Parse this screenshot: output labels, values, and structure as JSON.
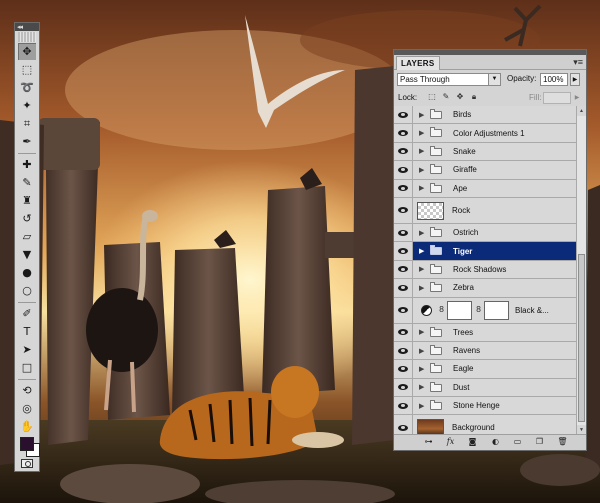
{
  "toolbox": {
    "collapse_glyph": "◂◂",
    "tools": [
      {
        "icon": "move-icon",
        "glyph": "✥",
        "active": true
      },
      {
        "icon": "marquee-icon",
        "glyph": "⬚"
      },
      {
        "icon": "lasso-icon",
        "glyph": "➰"
      },
      {
        "icon": "magic-wand-icon",
        "glyph": "✦"
      },
      {
        "icon": "crop-icon",
        "glyph": "⌗"
      },
      {
        "icon": "eyedropper-icon",
        "glyph": "✒"
      },
      {
        "sep": true
      },
      {
        "icon": "healing-brush-icon",
        "glyph": "✚"
      },
      {
        "icon": "brush-icon",
        "glyph": "✎"
      },
      {
        "icon": "clone-stamp-icon",
        "glyph": "♜"
      },
      {
        "icon": "history-brush-icon",
        "glyph": "↺"
      },
      {
        "icon": "eraser-icon",
        "glyph": "▱"
      },
      {
        "icon": "paint-bucket-icon",
        "glyph": "▼"
      },
      {
        "icon": "blur-icon",
        "glyph": "●"
      },
      {
        "icon": "dodge-icon",
        "glyph": "○"
      },
      {
        "sep": true
      },
      {
        "icon": "pen-icon",
        "glyph": "✐"
      },
      {
        "icon": "type-icon",
        "glyph": "T"
      },
      {
        "icon": "path-selection-icon",
        "glyph": "➤"
      },
      {
        "icon": "rectangle-shape-icon",
        "glyph": "□"
      },
      {
        "sep": true
      },
      {
        "icon": "3d-rotate-icon",
        "glyph": "⟲"
      },
      {
        "icon": "3d-orbit-icon",
        "glyph": "◎"
      },
      {
        "icon": "hand-icon",
        "glyph": "✋"
      },
      {
        "icon": "zoom-icon",
        "glyph": "⚲"
      }
    ],
    "foreground_color": "#2b0f2e",
    "background_color": "#ffffff",
    "quick_mask_icon": "quick-mask-icon"
  },
  "layers_panel": {
    "tab_label": "LAYERS",
    "menu_glyph": "▾≡",
    "blend_mode": "Pass Through",
    "opacity_label": "Opacity:",
    "opacity_value": "100%",
    "lock_label": "Lock:",
    "fill_label": "Fill:",
    "fill_value": "",
    "selected_color": "#0b2a78",
    "layers": [
      {
        "name": "Birds",
        "kind": "group"
      },
      {
        "name": "Color Adjustments 1",
        "kind": "group"
      },
      {
        "name": "Snake",
        "kind": "group"
      },
      {
        "name": "Giraffe",
        "kind": "group"
      },
      {
        "name": "Ape",
        "kind": "group"
      },
      {
        "name": "Rock",
        "kind": "pixel"
      },
      {
        "name": "Ostrich",
        "kind": "group"
      },
      {
        "name": "Tiger",
        "kind": "group",
        "selected": true
      },
      {
        "name": "Rock Shadows",
        "kind": "group"
      },
      {
        "name": "Zebra",
        "kind": "group"
      },
      {
        "name": "Black &...",
        "kind": "adjustment"
      },
      {
        "name": "Trees",
        "kind": "group"
      },
      {
        "name": "Ravens",
        "kind": "group"
      },
      {
        "name": "Eagle",
        "kind": "group"
      },
      {
        "name": "Dust",
        "kind": "group"
      },
      {
        "name": "Stone Henge",
        "kind": "group"
      },
      {
        "name": "Background",
        "kind": "background"
      }
    ],
    "footer_icons": [
      "link-layers-icon",
      "fx-icon",
      "add-mask-icon",
      "new-adjustment-icon",
      "new-group-icon",
      "new-layer-icon",
      "trash-icon"
    ]
  }
}
